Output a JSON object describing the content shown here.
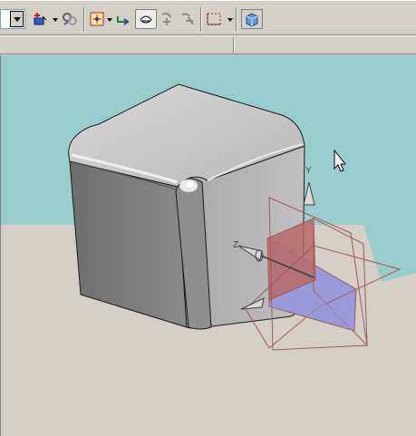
{
  "toolbar": {
    "view_combo": {
      "value": ""
    },
    "tools": [
      {
        "name": "insert-sketch-icon"
      },
      {
        "name": "relations-icon"
      },
      {
        "name": "smart-dimension-icon"
      },
      {
        "name": "convert-entities-icon"
      },
      {
        "name": "rebuild-icon"
      },
      {
        "name": "rotate-view-icon"
      },
      {
        "name": "pan-view-icon"
      },
      {
        "name": "select-box-icon"
      },
      {
        "name": "view-cube-icon"
      }
    ]
  },
  "viewport": {
    "background_top": "#99cccc",
    "background_bottom": "#d4d0c8",
    "model": "rounded-cube",
    "triad": {
      "axis_z": "Z",
      "axis_y": "Y"
    },
    "colors": {
      "cube_top": "#c9c9c9",
      "cube_left": "#7a7a7a",
      "cube_right": "#b0b0b0",
      "plane_edge": "#a05a5a",
      "plane_fill_red": "#b86868",
      "plane_fill_blue": "#9a9ad8"
    }
  }
}
